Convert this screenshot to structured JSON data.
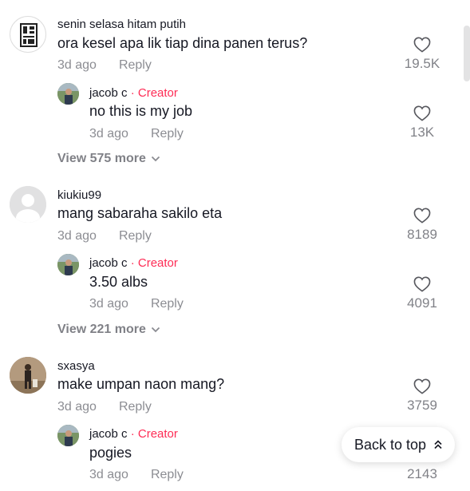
{
  "comments": [
    {
      "username": "senin selasa hitam putih",
      "text": "ora kesel apa lik tiap dina panen terus?",
      "time": "3d ago",
      "reply_label": "Reply",
      "likes": "19.5K",
      "reply": {
        "username": "jacob c",
        "creator_label": "· Creator",
        "text": "no this is my job",
        "time": "3d ago",
        "reply_label": "Reply",
        "likes": "13K"
      },
      "view_more": "View 575 more"
    },
    {
      "username": "kiukiu99",
      "text": "mang sabaraha sakilo eta",
      "time": "3d ago",
      "reply_label": "Reply",
      "likes": "8189",
      "reply": {
        "username": "jacob c",
        "creator_label": "· Creator",
        "text": "3.50 albs",
        "time": "3d ago",
        "reply_label": "Reply",
        "likes": "4091"
      },
      "view_more": "View 221 more"
    },
    {
      "username": "sxasya",
      "text": "make umpan naon mang?",
      "time": "3d ago",
      "reply_label": "Reply",
      "likes": "3759",
      "reply": {
        "username": "jacob c",
        "creator_label": "· Creator",
        "text": "pogies",
        "time": "3d ago",
        "reply_label": "Reply",
        "likes": "2143"
      }
    }
  ],
  "back_to_top": "Back to top",
  "colors": {
    "creator": "#fe2c55",
    "muted": "#8a8b91",
    "text": "#161823"
  },
  "icons": [
    "heart-outline-icon",
    "chevron-down-icon",
    "double-chevron-up-icon"
  ]
}
